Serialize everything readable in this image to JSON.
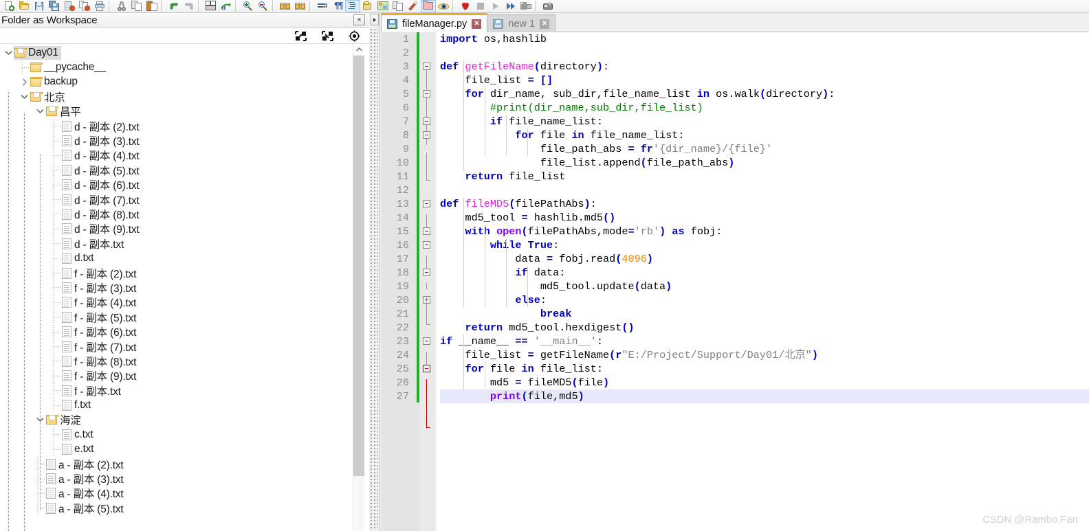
{
  "toolbar": {
    "groups": [
      {
        "items": [
          {
            "name": "new-file-icon",
            "label": "New"
          },
          {
            "name": "open-file-icon",
            "label": "Open"
          },
          {
            "name": "save-icon",
            "label": "Save"
          },
          {
            "name": "save-all-icon",
            "label": "Save All"
          },
          {
            "name": "close-icon",
            "label": "Close"
          },
          {
            "name": "close-all-icon",
            "label": "Close All"
          },
          {
            "name": "print-icon",
            "label": "Print"
          }
        ]
      },
      {
        "items": [
          {
            "name": "cut-icon",
            "label": "Cut"
          },
          {
            "name": "copy-icon",
            "label": "Copy"
          },
          {
            "name": "paste-icon",
            "label": "Paste"
          }
        ]
      },
      {
        "items": [
          {
            "name": "undo-icon",
            "label": "Undo"
          },
          {
            "name": "redo-icon",
            "label": "Redo"
          }
        ]
      },
      {
        "items": [
          {
            "name": "find-icon",
            "label": "Find"
          },
          {
            "name": "replace-icon",
            "label": "Replace"
          }
        ]
      },
      {
        "items": [
          {
            "name": "zoom-in-icon",
            "label": "Zoom In"
          },
          {
            "name": "zoom-out-icon",
            "label": "Zoom Out"
          }
        ]
      },
      {
        "items": [
          {
            "name": "sync-vertical-icon",
            "label": "Synchronize Vertical Scrolling"
          },
          {
            "name": "sync-horizontal-icon",
            "label": "Synchronize Horizontal Scrolling"
          }
        ]
      },
      {
        "items": [
          {
            "name": "word-wrap-icon",
            "label": "Word wrap"
          },
          {
            "name": "show-all-chars-icon",
            "label": "Show All Characters"
          },
          {
            "name": "indent-guide-icon",
            "label": "Show Indent Guide"
          },
          {
            "name": "user-define-dialog-icon",
            "label": "User Defined Dialogue"
          },
          {
            "name": "document-map-icon",
            "label": "Document Map"
          },
          {
            "name": "function-list-icon",
            "label": "Function List"
          },
          {
            "name": "folder-as-workspace-icon",
            "label": "Folder as Workspace"
          },
          {
            "name": "monitoring-icon",
            "label": "Monitoring"
          }
        ]
      },
      {
        "items": [
          {
            "name": "record-macro-icon",
            "label": "Start Recording"
          },
          {
            "name": "stop-macro-icon",
            "label": "Stop Recording"
          },
          {
            "name": "playback-macro-icon",
            "label": "Playback"
          },
          {
            "name": "run-macro-multiple-icon",
            "label": "Run a Macro Multiple Times"
          },
          {
            "name": "save-macro-icon",
            "label": "Save Current Recorded Macro"
          }
        ]
      },
      {
        "items": [
          {
            "name": "run-icon",
            "label": "Run"
          }
        ]
      }
    ]
  },
  "workspace_panel": {
    "title": "Folder as Workspace",
    "close_label": "×",
    "actions": [
      {
        "name": "expand-all-icon",
        "label": "Expand All"
      },
      {
        "name": "collapse-all-icon",
        "label": "Collapse All"
      },
      {
        "name": "locate-current-file-icon",
        "label": "Locate Current File"
      }
    ],
    "tree": [
      {
        "depth": 0,
        "type": "folder-open",
        "label": "Day01",
        "expander": "down",
        "selected": true
      },
      {
        "depth": 1,
        "type": "folder",
        "label": "__pycache__",
        "expander": "none"
      },
      {
        "depth": 1,
        "type": "folder",
        "label": "backup",
        "expander": "right"
      },
      {
        "depth": 1,
        "type": "folder-open",
        "label": "北京",
        "expander": "down"
      },
      {
        "depth": 2,
        "type": "folder-open",
        "label": "昌平",
        "expander": "down"
      },
      {
        "depth": 3,
        "type": "file",
        "label": "d - 副本 (2).txt",
        "expander": "none"
      },
      {
        "depth": 3,
        "type": "file",
        "label": "d - 副本 (3).txt",
        "expander": "none"
      },
      {
        "depth": 3,
        "type": "file",
        "label": "d - 副本 (4).txt",
        "expander": "none"
      },
      {
        "depth": 3,
        "type": "file",
        "label": "d - 副本 (5).txt",
        "expander": "none"
      },
      {
        "depth": 3,
        "type": "file",
        "label": "d - 副本 (6).txt",
        "expander": "none"
      },
      {
        "depth": 3,
        "type": "file",
        "label": "d - 副本 (7).txt",
        "expander": "none"
      },
      {
        "depth": 3,
        "type": "file",
        "label": "d - 副本 (8).txt",
        "expander": "none"
      },
      {
        "depth": 3,
        "type": "file",
        "label": "d - 副本 (9).txt",
        "expander": "none"
      },
      {
        "depth": 3,
        "type": "file",
        "label": "d - 副本.txt",
        "expander": "none"
      },
      {
        "depth": 3,
        "type": "file",
        "label": "d.txt",
        "expander": "none"
      },
      {
        "depth": 3,
        "type": "file",
        "label": "f - 副本 (2).txt",
        "expander": "none"
      },
      {
        "depth": 3,
        "type": "file",
        "label": "f - 副本 (3).txt",
        "expander": "none"
      },
      {
        "depth": 3,
        "type": "file",
        "label": "f - 副本 (4).txt",
        "expander": "none"
      },
      {
        "depth": 3,
        "type": "file",
        "label": "f - 副本 (5).txt",
        "expander": "none"
      },
      {
        "depth": 3,
        "type": "file",
        "label": "f - 副本 (6).txt",
        "expander": "none"
      },
      {
        "depth": 3,
        "type": "file",
        "label": "f - 副本 (7).txt",
        "expander": "none"
      },
      {
        "depth": 3,
        "type": "file",
        "label": "f - 副本 (8).txt",
        "expander": "none"
      },
      {
        "depth": 3,
        "type": "file",
        "label": "f - 副本 (9).txt",
        "expander": "none"
      },
      {
        "depth": 3,
        "type": "file",
        "label": "f - 副本.txt",
        "expander": "none"
      },
      {
        "depth": 3,
        "type": "file",
        "label": "f.txt",
        "expander": "none"
      },
      {
        "depth": 2,
        "type": "folder-open",
        "label": "海淀",
        "expander": "down"
      },
      {
        "depth": 3,
        "type": "file",
        "label": "c.txt",
        "expander": "none"
      },
      {
        "depth": 3,
        "type": "file",
        "label": "e.txt",
        "expander": "none"
      },
      {
        "depth": 2,
        "type": "file",
        "label": "a - 副本 (2).txt",
        "expander": "none"
      },
      {
        "depth": 2,
        "type": "file",
        "label": "a - 副本 (3).txt",
        "expander": "none"
      },
      {
        "depth": 2,
        "type": "file",
        "label": "a - 副本 (4).txt",
        "expander": "none"
      },
      {
        "depth": 2,
        "type": "file",
        "label": "a - 副本 (5).txt",
        "expander": "none"
      }
    ]
  },
  "editor": {
    "tabs": [
      {
        "label": "fileManager.py",
        "active": true,
        "close_label": "✕"
      },
      {
        "label": "new 1",
        "active": false,
        "close_label": "✕"
      }
    ],
    "line_numbers": [
      "1",
      "2",
      "3",
      "4",
      "5",
      "6",
      "7",
      "8",
      "9",
      "10",
      "11",
      "12",
      "13",
      "14",
      "15",
      "16",
      "17",
      "18",
      "19",
      "20",
      "21",
      "22",
      "23",
      "24",
      "25",
      "26",
      "27"
    ],
    "code_lines": [
      "import os,hashlib",
      "",
      "def getFileName(directory):",
      "    file_list = []",
      "    for dir_name, sub_dir,file_name_list in os.walk(directory):",
      "        #print(dir_name,sub_dir,file_list)",
      "        if file_name_list:",
      "            for file in file_name_list:",
      "                file_path_abs = fr'{dir_name}/{file}'",
      "                file_list.append(file_path_abs)",
      "    return file_list",
      "",
      "def fileMD5(filePathAbs):",
      "    md5_tool = hashlib.md5()",
      "    with open(filePathAbs,mode='rb') as fobj:",
      "        while True:",
      "            data = fobj.read(4096)",
      "            if data:",
      "                md5_tool.update(data)",
      "            else:",
      "                break",
      "    return md5_tool.hexdigest()",
      "if __name__ == '__main__':",
      "    file_list = getFileName(r\"E:/Project/Support/Day01/北京\")",
      "    for file in file_list:",
      "        md5 = fileMD5(file)",
      "        print(file,md5)"
    ],
    "current_line": 27,
    "colors": {
      "keyword": "#0000c0",
      "function": "#e81ee8",
      "comment": "#008000",
      "string": "#808080",
      "number": "#ff8000",
      "builtin": "#8000ff",
      "modified_marker": "#1faf1f",
      "active_tab_accent": "#f5a623"
    }
  },
  "watermark": "CSDN @Rambo.Fan"
}
